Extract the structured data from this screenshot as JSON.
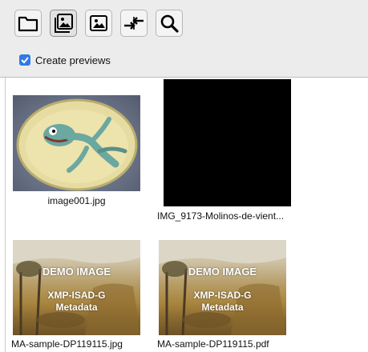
{
  "toolbar": {
    "buttons": [
      {
        "name": "open-folder-button",
        "icon": "folder-icon"
      },
      {
        "name": "thumbnail-view-button",
        "icon": "stacked-images-icon",
        "active": true
      },
      {
        "name": "image-view-button",
        "icon": "image-icon"
      },
      {
        "name": "compare-button",
        "icon": "arrows-in-icon"
      },
      {
        "name": "search-button",
        "icon": "magnifier-icon"
      }
    ]
  },
  "options": {
    "create_previews_label": "Create previews",
    "create_previews_checked": true
  },
  "thumbnails": [
    {
      "filename": "image001.jpg"
    },
    {
      "filename": "IMG_9173-Molinos-de-vient..."
    },
    {
      "filename": "MA-sample-DP119115.jpg",
      "overlay": [
        "DEMO IMAGE",
        "XMP-ISAD-G",
        "Metadata"
      ]
    },
    {
      "filename": "MA-sample-DP119115.pdf",
      "overlay": [
        "DEMO IMAGE",
        "XMP-ISAD-G",
        "Metadata"
      ]
    }
  ],
  "colors": {
    "accent": "#2f7ae5",
    "toolbar_bg": "#ececec",
    "black_thumbnail": "#000000"
  }
}
